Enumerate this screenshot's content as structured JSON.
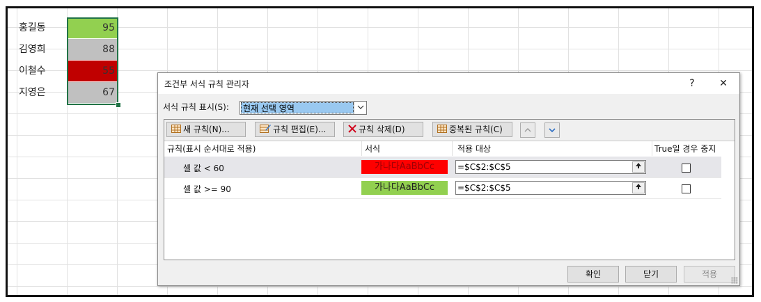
{
  "spreadsheet": {
    "rows": [
      {
        "name": "홍길동",
        "value": "95",
        "fill": "#92d050"
      },
      {
        "name": "김영희",
        "value": "88",
        "fill": "#c0c0c0"
      },
      {
        "name": "이철수",
        "value": "55",
        "fill": "#c00000"
      },
      {
        "name": "지영은",
        "value": "67",
        "fill": "#c0c0c0"
      }
    ]
  },
  "dialog": {
    "title": "조건부 서식 규칙 관리자",
    "help_label": "?",
    "close_label": "✕",
    "show_label": "서식 규칙 표시(S):",
    "show_value": "현재 선택 영역",
    "toolbar": {
      "new_rule": "새 규칙(N)...",
      "edit_rule": "규칙 편집(E)...",
      "delete_rule": "규칙 삭제(D)",
      "duplicate_rule": "중복된 규칙(C)"
    },
    "columns": {
      "rule": "규칙(표시 순서대로 적용)",
      "format": "서식",
      "applies_to": "적용 대상",
      "stop_if_true": "True일 경우 중지"
    },
    "rules": [
      {
        "rule": "셀 값 < 60",
        "format_preview": "가나다AaBbCc",
        "format_bg": "#ff0000",
        "format_fg": "#9c0006",
        "applies_to": "=$C$2:$C$5",
        "stop": false
      },
      {
        "rule": "셀 값 >= 90",
        "format_preview": "가나다AaBbCc",
        "format_bg": "#92d050",
        "format_fg": "#1f1f1f",
        "applies_to": "=$C$2:$C$5",
        "stop": false
      }
    ],
    "buttons": {
      "ok": "확인",
      "close": "닫기",
      "apply": "적용"
    }
  }
}
